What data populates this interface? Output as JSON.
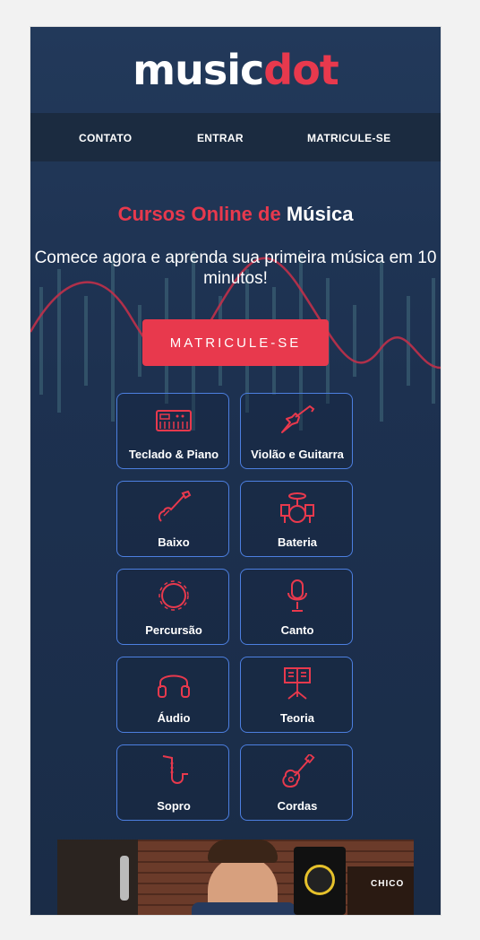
{
  "brand": {
    "logo_part1": "music",
    "logo_part2": "dot",
    "accent": "#e8394d",
    "button_border": "#4c7fe0"
  },
  "nav": {
    "items": [
      "CONTATO",
      "ENTRAR",
      "MATRICULE-SE"
    ]
  },
  "hero": {
    "title_red": "Cursos Online de",
    "title_white": "Música",
    "subtitle": "Comece agora e aprenda sua primeira música em 10 minutos!",
    "cta": "MATRICULE-SE"
  },
  "courses": [
    {
      "label": "Teclado & Piano",
      "icon": "keyboard-icon"
    },
    {
      "label": "Violão e Guitarra",
      "icon": "electric-guitar-icon"
    },
    {
      "label": "Baixo",
      "icon": "bass-guitar-icon"
    },
    {
      "label": "Bateria",
      "icon": "drum-kit-icon"
    },
    {
      "label": "Percursão",
      "icon": "tambourine-icon"
    },
    {
      "label": "Canto",
      "icon": "microphone-icon"
    },
    {
      "label": "Áudio",
      "icon": "headphones-icon"
    },
    {
      "label": "Teoria",
      "icon": "music-stand-icon"
    },
    {
      "label": "Sopro",
      "icon": "saxophone-icon"
    },
    {
      "label": "Cordas",
      "icon": "acoustic-guitar-icon"
    }
  ],
  "video": {
    "sign_text": "CHICO"
  }
}
